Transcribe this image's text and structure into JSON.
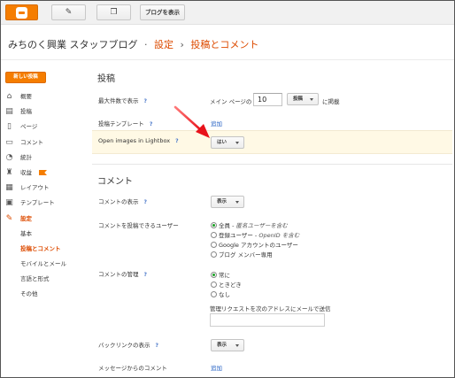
{
  "topbar": {
    "logo_icon": "blogger-logo-icon",
    "edit_icon": "pencil-icon",
    "pages_icon": "copy-pages-icon",
    "view_blog": "ブログを表示"
  },
  "breadcrumb": {
    "blog": "みちのく興業  スタッフブログ",
    "sep1": "·",
    "section": "設定",
    "sep2": "›",
    "page": "投稿とコメント"
  },
  "sidebar": {
    "new_post": "新しい投稿",
    "items": [
      {
        "label": "概要",
        "icon": "home-icon",
        "glyph": "⌂"
      },
      {
        "label": "投稿",
        "icon": "posts-icon",
        "glyph": "▤"
      },
      {
        "label": "ページ",
        "icon": "pages-icon",
        "glyph": "▯"
      },
      {
        "label": "コメント",
        "icon": "comment-icon",
        "glyph": "▭"
      },
      {
        "label": "統計",
        "icon": "stats-icon",
        "glyph": "◔"
      },
      {
        "label": "収益",
        "icon": "trophy-icon",
        "glyph": "♜"
      },
      {
        "label": "レイアウト",
        "icon": "layout-icon",
        "glyph": "▦"
      },
      {
        "label": "テンプレート",
        "icon": "template-icon",
        "glyph": "▣"
      },
      {
        "label": "設定",
        "icon": "wrench-icon",
        "glyph": "✎"
      }
    ],
    "sub_items": [
      "基本",
      "投稿とコメント",
      "モバイルとメール",
      "言語と形式",
      "その他"
    ]
  },
  "posts": {
    "title": "投稿",
    "max_label": "最大件数で表示",
    "max_prefix": "メイン ページの",
    "max_value": "10",
    "max_unit": "投稿",
    "max_suffix": "に掲載",
    "template_label": "投稿テンプレート",
    "template_link": "追加",
    "lightbox_label": "Open images in Lightbox",
    "lightbox_value": "はい"
  },
  "comments": {
    "title": "コメント",
    "display_label": "コメントの表示",
    "display_value": "表示",
    "who_label": "コメントを投稿できるユーザー",
    "who_options": [
      {
        "label": "全員 - ",
        "note": "匿名ユーザーを含む",
        "selected": true
      },
      {
        "label": "登録ユーザー - ",
        "note": "OpenID を含む",
        "selected": false
      },
      {
        "label": "Google アカウントのユーザー",
        "note": "",
        "selected": false
      },
      {
        "label": "ブログ メンバー専用",
        "note": "",
        "selected": false
      }
    ],
    "moderation_label": "コメントの管理",
    "moderation_options": [
      {
        "label": "常に",
        "selected": true
      },
      {
        "label": "ときどき",
        "selected": false
      },
      {
        "label": "なし",
        "selected": false
      }
    ],
    "moderation_email": "管理リクエストを次のアドレスにメールで送信",
    "backlinks_label": "バックリンクの表示",
    "backlinks_value": "表示",
    "message_label": "メッセージからのコメント",
    "message_link": "追加"
  },
  "help_mark": "?",
  "colors": {
    "accent": "#f57d00",
    "active_text": "#dd4b00",
    "link": "#1e5cc2",
    "highlight": "#fff9e5",
    "radio_on": "#1aa025",
    "annotation_arrow": "#e8121a"
  }
}
